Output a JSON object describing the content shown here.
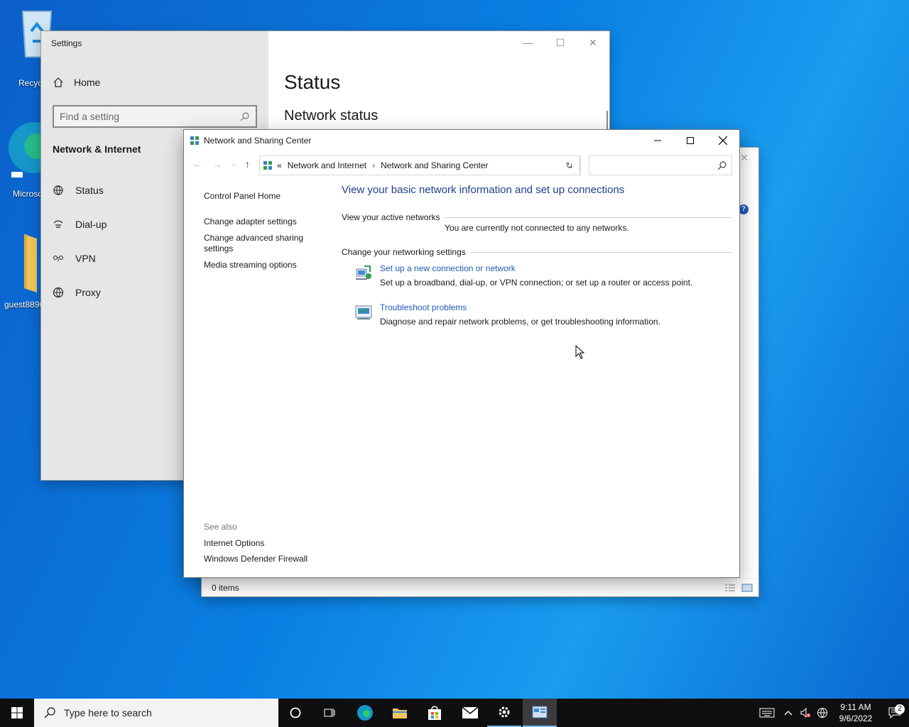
{
  "desktop": {
    "icons": [
      {
        "label": "Recyc"
      },
      {
        "label": "Microsc"
      },
      {
        "label": "guest8896"
      }
    ]
  },
  "settings_window": {
    "title": "Settings",
    "home_label": "Home",
    "search_placeholder": "Find a setting",
    "section_title": "Network & Internet",
    "nav_items": [
      {
        "label": "Status",
        "icon": "status-icon"
      },
      {
        "label": "Dial-up",
        "icon": "dialup-icon"
      },
      {
        "label": "VPN",
        "icon": "vpn-icon"
      },
      {
        "label": "Proxy",
        "icon": "globe-icon"
      }
    ],
    "page_title": "Status",
    "subtitle": "Network status"
  },
  "behind_window": {
    "status_text": "0 items"
  },
  "nsc": {
    "title": "Network and Sharing Center",
    "address": {
      "overflow": "«",
      "crumbs": [
        "Network and Internet",
        "Network and Sharing Center"
      ]
    },
    "search_placeholder": "",
    "left_links": [
      "Control Panel Home",
      "Change adapter settings",
      "Change advanced sharing settings",
      "Media streaming options"
    ],
    "see_also_title": "See also",
    "see_also_links": [
      "Internet Options",
      "Windows Defender Firewall"
    ],
    "heading": "View your basic network information and set up connections",
    "active_networks_label": "View your active networks",
    "not_connected": "You are currently not connected to any networks.",
    "change_settings_label": "Change your networking settings",
    "tasks": [
      {
        "link": "Set up a new connection or network",
        "desc": "Set up a broadband, dial-up, or VPN connection; or set up a router or access point.",
        "icon": "new-connection-icon"
      },
      {
        "link": "Troubleshoot problems",
        "desc": "Diagnose and repair network problems, or get troubleshooting information.",
        "icon": "troubleshoot-icon"
      }
    ]
  },
  "taskbar": {
    "search_placeholder": "Type here to search",
    "time": "9:11 AM",
    "date": "9/6/2022",
    "notification_count": "2"
  },
  "colors": {
    "accent": "#0078d7",
    "link": "#1e5bb8",
    "heading": "#1e3f8f"
  }
}
